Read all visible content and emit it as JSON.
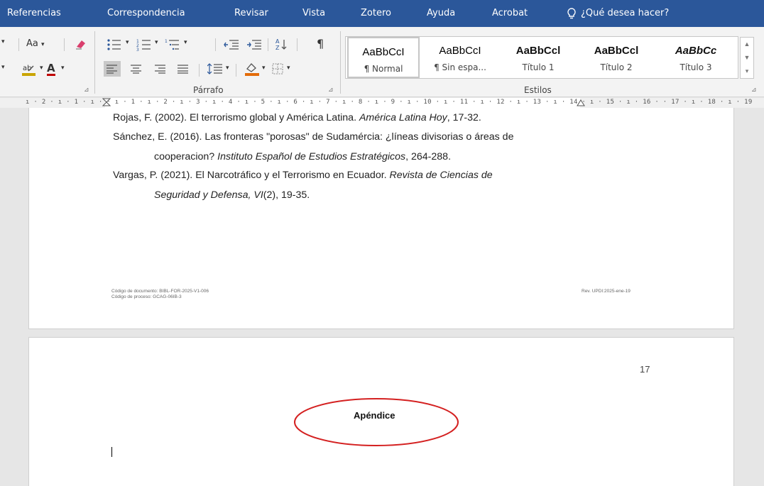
{
  "tabs": [
    "Referencias",
    "Correspondencia",
    "Revisar",
    "Vista",
    "Zotero",
    "Ayuda",
    "Acrobat"
  ],
  "tell_me": "¿Qué desea hacer?",
  "ribbon": {
    "font_case": "Aa",
    "font_color_letter": "A",
    "paragraph_label": "Párrafo",
    "styles_label": "Estilos",
    "pilcrow": "¶",
    "styles": [
      {
        "sample": "AaBbCcI",
        "name": "¶ Normal"
      },
      {
        "sample": "AaBbCcI",
        "name": "¶ Sin espa..."
      },
      {
        "sample": "AaBbCcl",
        "name": "Título 1"
      },
      {
        "sample": "AaBbCcl",
        "name": "Título 2"
      },
      {
        "sample": "AaBbCc",
        "name": "Título 3"
      }
    ]
  },
  "ruler": "ı · 2 · ı · 1 · ı ·   · ı · 1 · ı · 2 · ı · 3 · ı · 4 · ı · 5 · ı · 6 · ı · 7 · ı · 8 · ı · 9 · ı · 10 · ı · 11 · ı · 12 · ı · 13 · ı · 14 · ı · 15 · ı · 16 ·   · 17 · ı · 18 · ı · 19",
  "references": {
    "r1": {
      "a": "Rojas, F. (2002). El terrorismo global y América Latina. ",
      "b": "América Latina Hoy",
      "c": ", 17-32."
    },
    "r2a": "Sánchez, E. (2016). Las fronteras \"porosas\" de Sudamércia: ¿líneas divisorias o áreas de",
    "r2b": {
      "a": "cooperacion? ",
      "b": "Instituto Español de Estudios Estratégicos",
      "c": ", 264-288."
    },
    "r3a": {
      "a": "Vargas, P. (2021). El Narcotráfico y el Terrorismo en Ecuador. ",
      "b": "Revista de Ciencias de"
    },
    "r3b": {
      "a": "Seguridad y Defensa, VI",
      "b": "(2), 19-35."
    }
  },
  "footer": {
    "doc_code": "Código de documento: BIBL-FOR-2025-V1-006",
    "process_code": "Código de proceso: GCAG-06IB-3",
    "revision": "Rev. UPDI:2025-ene-19"
  },
  "page2": {
    "page_number": "17",
    "heading": "Apéndice"
  },
  "colors": {
    "ribbon_blue": "#2b579a",
    "annotation_red": "#d42020"
  }
}
